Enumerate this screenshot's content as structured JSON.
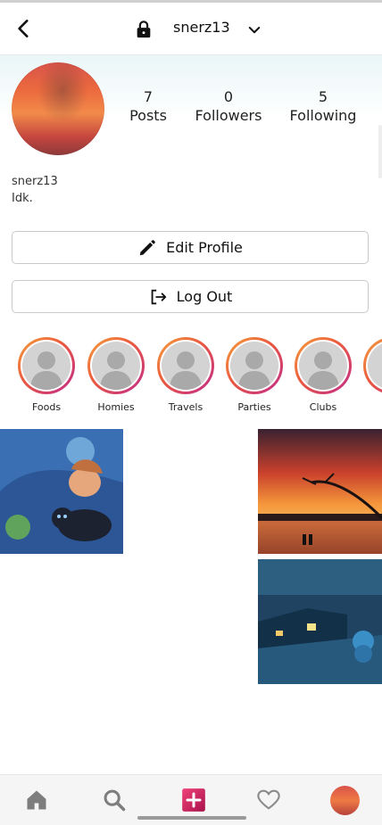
{
  "header": {
    "username": "snerz13",
    "icons": {
      "back": "back-arrow-icon",
      "lock": "lock-icon",
      "dropdown": "chevron-down-icon"
    }
  },
  "stats": [
    {
      "value": "7",
      "label": "Posts"
    },
    {
      "value": "0",
      "label": "Followers"
    },
    {
      "value": "5",
      "label": "Following"
    }
  ],
  "bio": {
    "name": "snerz13",
    "text": "Idk."
  },
  "buttons": {
    "edit_profile": "Edit Profile",
    "log_out": "Log Out"
  },
  "highlights": [
    {
      "label": "Foods"
    },
    {
      "label": "Homies"
    },
    {
      "label": "Travels"
    },
    {
      "label": "Parties"
    },
    {
      "label": "Clubs"
    }
  ],
  "nav": {
    "icons": [
      "home-icon",
      "search-icon",
      "add-post-icon",
      "heart-icon",
      "profile-avatar"
    ]
  },
  "colors": {
    "ring_start": "#f6a23c",
    "ring_end": "#c02a8e",
    "add_button": "#d81b60"
  }
}
